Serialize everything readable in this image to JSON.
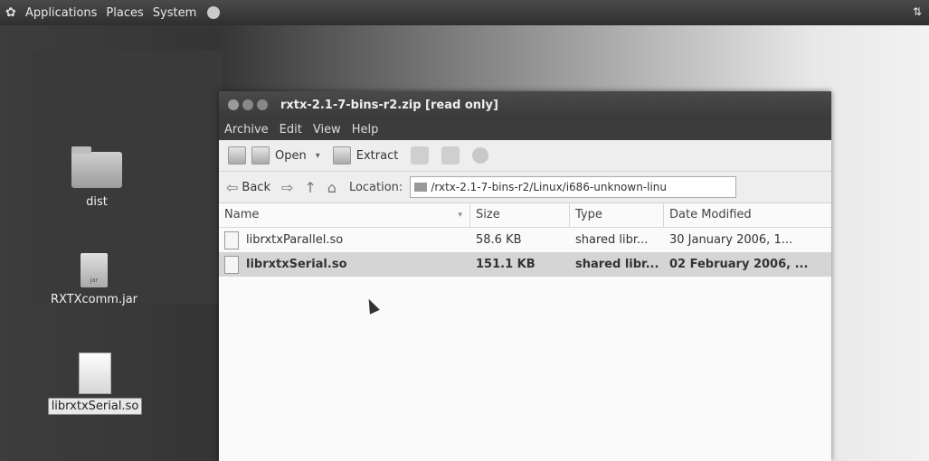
{
  "top_panel": {
    "menus": [
      "Applications",
      "Places",
      "System"
    ]
  },
  "desktop": {
    "icons": [
      {
        "label": "dist",
        "type": "folder"
      },
      {
        "label": "RXTXcomm.jar",
        "type": "jar",
        "badge": "jar"
      },
      {
        "label": "librxtxSerial.so",
        "type": "file",
        "selected": true
      }
    ]
  },
  "window": {
    "title": "rxtx-2.1-7-bins-r2.zip [read only]",
    "menu": [
      "Archive",
      "Edit",
      "View",
      "Help"
    ],
    "toolbar": {
      "open_label": "Open",
      "extract_label": "Extract"
    },
    "location": {
      "back_label": "Back",
      "label": "Location:",
      "path": "/rxtx-2.1-7-bins-r2/Linux/i686-unknown-linu"
    },
    "columns": [
      "Name",
      "Size",
      "Type",
      "Date Modified"
    ],
    "rows": [
      {
        "name": "librxtxParallel.so",
        "size": "58.6 KB",
        "type": "shared libr...",
        "date": "30 January 2006, 1...",
        "selected": false
      },
      {
        "name": "librxtxSerial.so",
        "size": "151.1 KB",
        "type": "shared libr...",
        "date": "02 February 2006, ...",
        "selected": true
      }
    ]
  },
  "icons": [
    "ubuntu-logo-icon",
    "back-arrow-icon",
    "forward-arrow-icon",
    "up-arrow-icon",
    "home-icon",
    "drive-icon",
    "file-icon",
    "folder-icon",
    "mouse-cursor-icon"
  ]
}
